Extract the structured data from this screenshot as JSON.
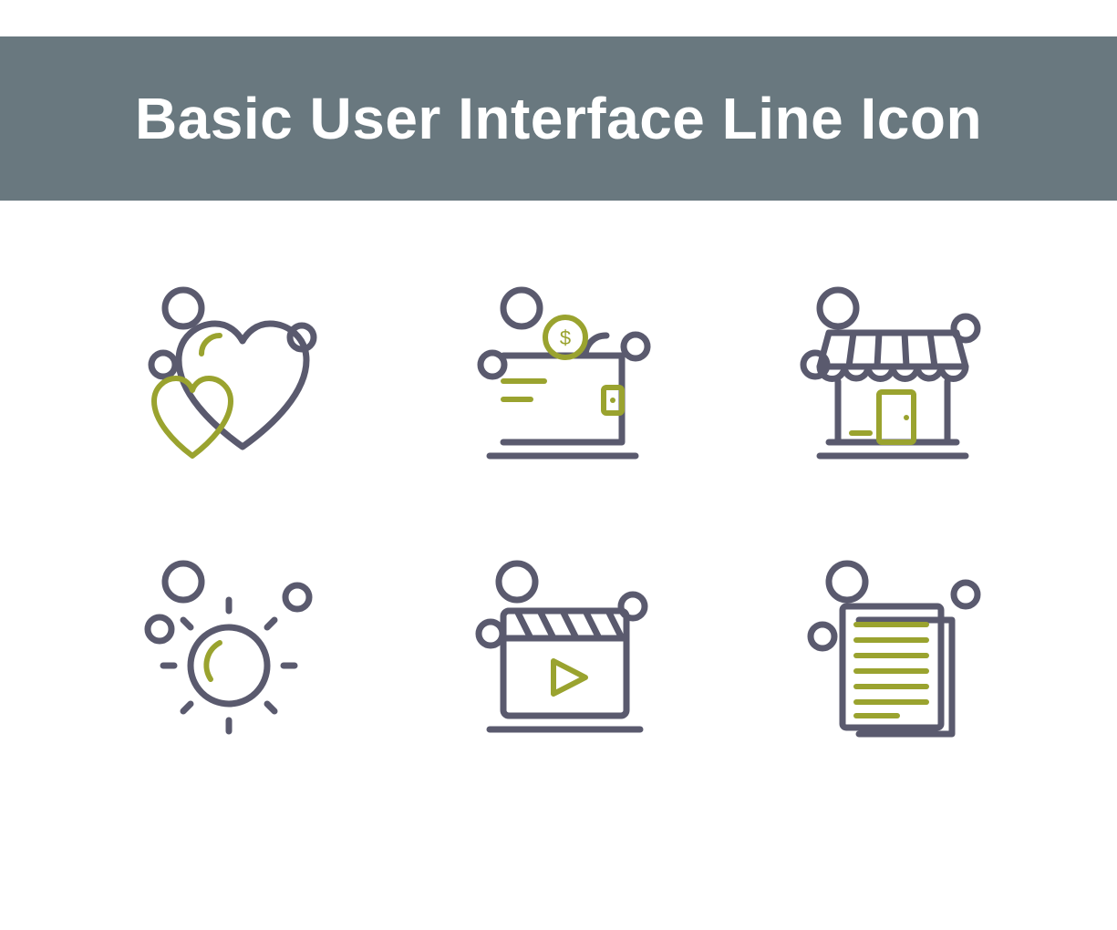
{
  "header": {
    "title": "Basic User Interface Line Icon"
  },
  "colors": {
    "header_bg": "#69787f",
    "stroke_primary": "#5a5a6e",
    "stroke_accent": "#9aa32f"
  },
  "icons": [
    {
      "name": "heart-icon",
      "label": "Heart / Favorite"
    },
    {
      "name": "wallet-icon",
      "label": "Wallet / Money"
    },
    {
      "name": "store-icon",
      "label": "Store / Shop"
    },
    {
      "name": "sun-icon",
      "label": "Sun / Brightness"
    },
    {
      "name": "video-icon",
      "label": "Video / Clapperboard"
    },
    {
      "name": "document-icon",
      "label": "Document / Files"
    }
  ]
}
